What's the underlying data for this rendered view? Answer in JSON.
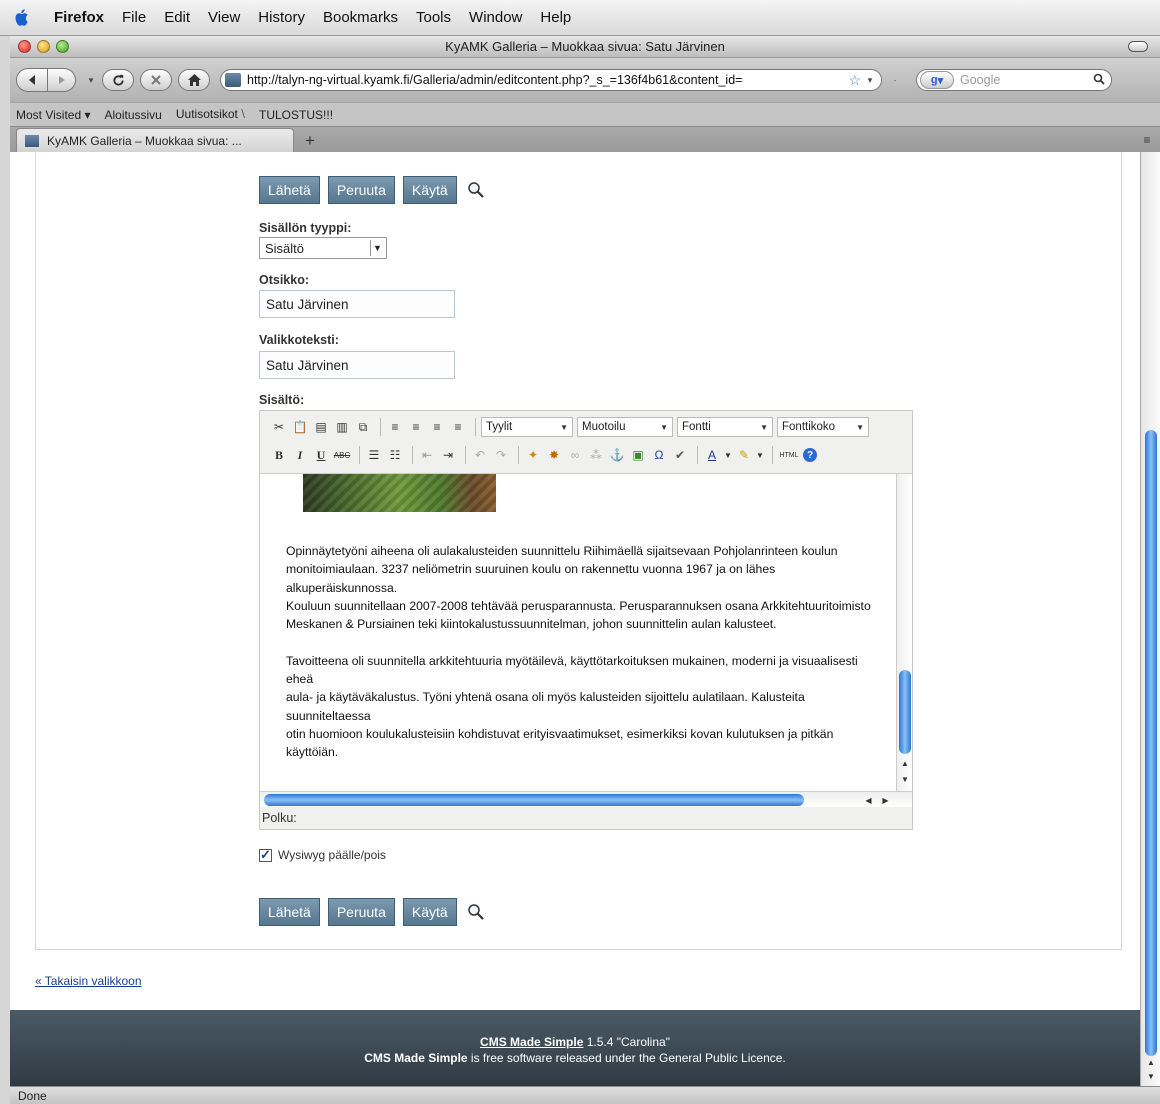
{
  "menubar": {
    "items": [
      "Firefox",
      "File",
      "Edit",
      "View",
      "History",
      "Bookmarks",
      "Tools",
      "Window",
      "Help"
    ]
  },
  "window": {
    "title": "KyAMK Galleria – Muokkaa sivua: Satu Järvinen"
  },
  "navbar": {
    "url": "http://talyn-ng-virtual.kyamk.fi/Galleria/admin/editcontent.php?_s_=136f4b61&content_id=",
    "search_placeholder": "Google",
    "search_engine_label": "g"
  },
  "bookmarks": {
    "items": [
      "Most Visited ▾",
      "Aloitussivu",
      "Uutisotsikot ⧵",
      "TULOSTUS!!!"
    ]
  },
  "tabs": {
    "active_title": "KyAMK Galleria – Muokkaa sivua: ...",
    "new_tab_label": "+"
  },
  "form": {
    "buttons_top": {
      "submit": "Lähetä",
      "cancel": "Peruuta",
      "apply": "Käytä"
    },
    "content_type_label": "Sisällön tyyppi:",
    "content_type_value": "Sisältö",
    "title_label": "Otsikko:",
    "title_value": "Satu Järvinen",
    "menu_text_label": "Valikkoteksti:",
    "menu_text_value": "Satu Järvinen",
    "content_label": "Sisältö:",
    "wysiwyg_label": "Wysiwyg päälle/pois",
    "wysiwyg_checked": true,
    "buttons_bottom": {
      "submit": "Lähetä",
      "cancel": "Peruuta",
      "apply": "Käytä"
    },
    "back_link": "« Takaisin valikkoon"
  },
  "editor": {
    "styles_select": "Tyylit",
    "format_select": "Muotoilu",
    "font_select": "Fontti",
    "fontsize_select": "Fonttikoko",
    "path_label": "Polku:",
    "lines": [
      "Opinnäytetyöni aiheena oli aulakalusteiden suunnittelu Riihimäellä sijaitsevaan Pohjolanrinteen koulun",
      "monitoimiaulaan. 3237 neliömetrin suuruinen koulu on rakennettu vuonna 1967 ja on lähes",
      "alkuperäiskunnossa.",
      "Kouluun suunnitellaan 2007-2008 tehtävää perusparannusta. Perusparannuksen osana Arkkitehtuuritoimisto",
      "Meskanen & Pursiainen teki kiintokalustussuunnitelman, johon suunnittelin aulan kalusteet.",
      "",
      "Tavoitteena oli suunnitella arkkitehtuuria myötäilevä, käyttötarkoituksen mukainen, moderni ja visuaalisesti",
      "eheä",
      "aula- ja käytäväkalustus. Työni yhtenä osana oli myös kalusteiden sijoittelu aulatilaan. Kalusteita",
      "suunniteltaessa",
      "otin huomioon koulukalusteisiin kohdistuvat erityisvaatimukset, esimerkiksi kovan kulutuksen ja pitkän",
      "käyttöiän."
    ]
  },
  "footer": {
    "line1_link": "CMS Made Simple",
    "line1_rest": " 1.5.4 \"Carolina\"",
    "line2_bold": "CMS Made Simple",
    "line2_rest": " is free software released under the General Public Licence."
  },
  "status": {
    "text": "Done"
  }
}
